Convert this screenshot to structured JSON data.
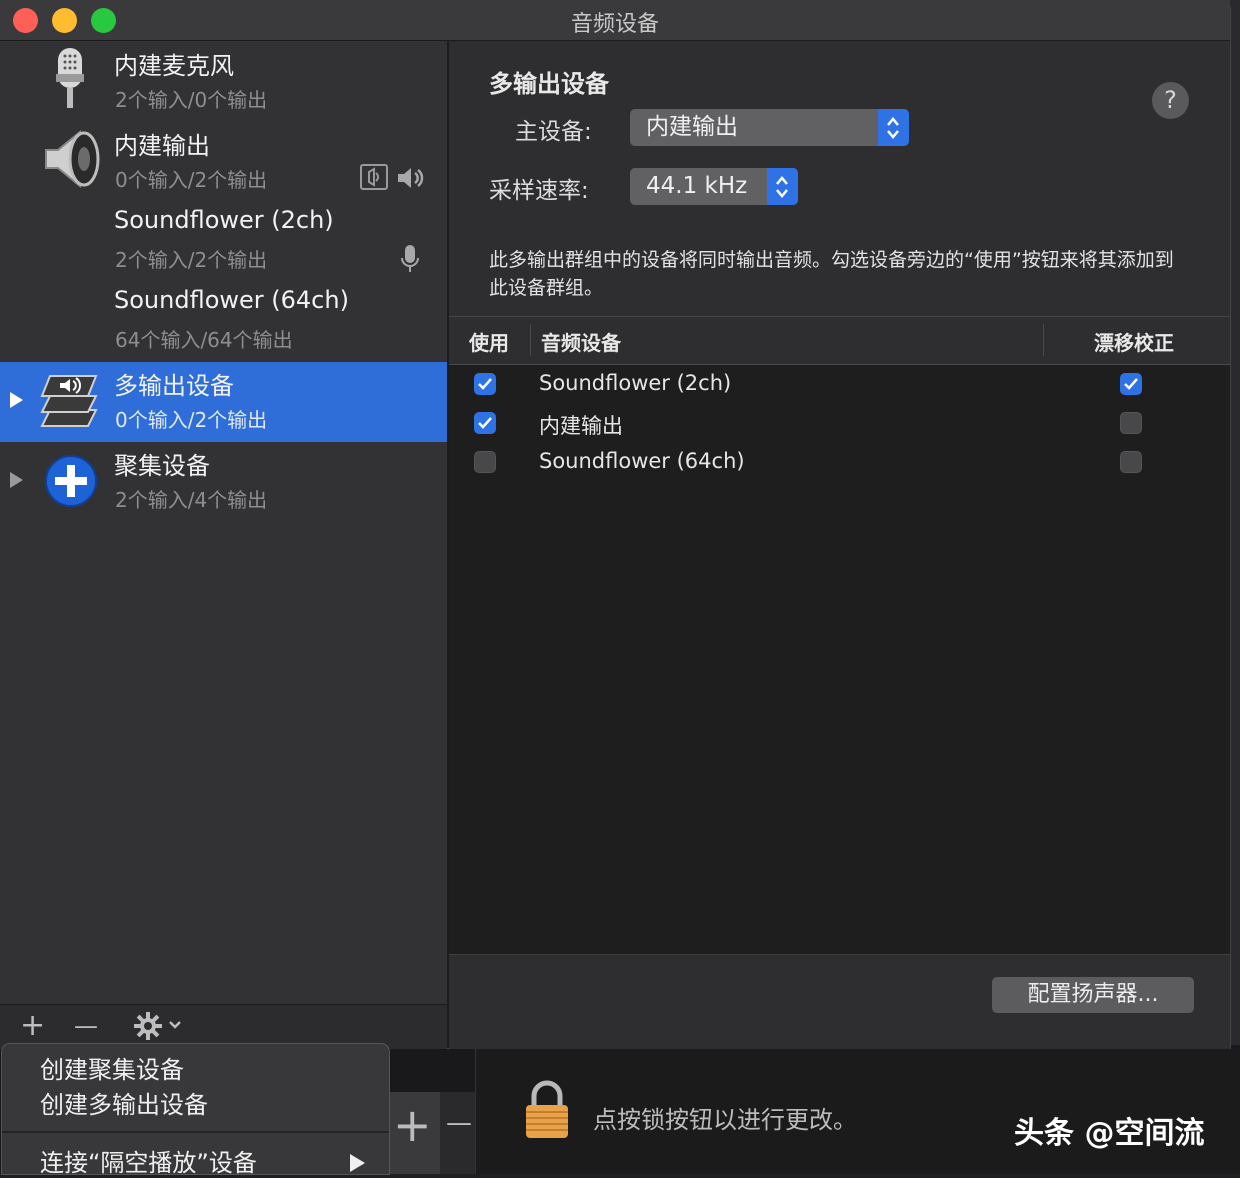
{
  "window": {
    "title": "音频设备"
  },
  "sidebar": {
    "devices": [
      {
        "name": "内建麦克风",
        "sub": "2个输入/0个输出",
        "icon": "microphone-icon"
      },
      {
        "name": "内建输出",
        "sub": "0个输入/2个输出",
        "icon": "speaker-icon"
      },
      {
        "name": "Soundflower (2ch)",
        "sub": "2个输入/2个输出"
      },
      {
        "name": "Soundflower (64ch)",
        "sub": "64个输入/64个输出"
      },
      {
        "name": "多输出设备",
        "sub": "0个输入/2个输出",
        "icon": "multi-output-icon",
        "selected": true
      },
      {
        "name": "聚集设备",
        "sub": "2个输入/4个输出",
        "icon": "aggregate-plus-icon"
      }
    ],
    "footer": {
      "add": "+",
      "remove": "—"
    }
  },
  "detail": {
    "title": "多输出设备",
    "help": "?",
    "master_label": "主设备:",
    "master_value": "内建输出",
    "rate_label": "采样速率:",
    "rate_value": "44.1 kHz",
    "description": "此多输出群组中的设备将同时输出音频。勾选设备旁边的“使用”按钮来将其添加到此设备群组。",
    "table": {
      "headers": {
        "use": "使用",
        "device": "音频设备",
        "drift": "漂移校正"
      },
      "rows": [
        {
          "name": "Soundflower (2ch)",
          "use": true,
          "drift": true
        },
        {
          "name": "内建输出",
          "use": true,
          "drift": false
        },
        {
          "name": "Soundflower (64ch)",
          "use": false,
          "drift": false
        }
      ]
    },
    "configure_button": "配置扬声器..."
  },
  "menu": {
    "items": [
      "创建聚集设备",
      "创建多输出设备",
      "连接“隔空播放”设备"
    ]
  },
  "lower": {
    "plus": "+",
    "minus": "—",
    "lock_text": "点按锁按钮以进行更改。"
  },
  "watermark": "头条 @空间流",
  "colors": {
    "accent": "#2f72e6",
    "selection": "#2f6ed8"
  }
}
